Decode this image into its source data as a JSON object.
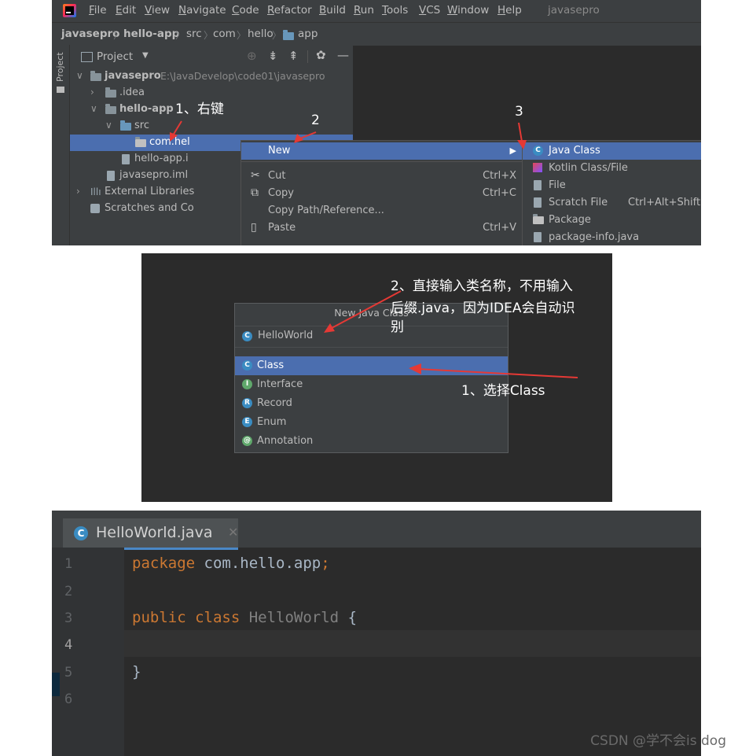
{
  "panel1": {
    "menu": [
      "File",
      "Edit",
      "View",
      "Navigate",
      "Code",
      "Refactor",
      "Build",
      "Run",
      "Tools",
      "VCS",
      "Window",
      "Help"
    ],
    "app_title": "javasepro",
    "breadcrumb": [
      "javasepro",
      "hello-app",
      "src",
      "com",
      "hello",
      "app"
    ],
    "project_tab": "Project",
    "project_header": "Project",
    "tree": {
      "root_name": "javasepro",
      "root_path": "E:\\JavaDevelop\\code01\\javasepro",
      "idea": ".idea",
      "module": "hello-app",
      "src": "src",
      "package": "com.hel",
      "module_iml": "hello-app.i",
      "project_iml": "javasepro.iml",
      "external_libs": "External Libraries",
      "scratches": "Scratches and Co"
    },
    "context_menu": {
      "new": "New",
      "cut": "Cut",
      "cut_sc": "Ctrl+X",
      "copy": "Copy",
      "copy_sc": "Ctrl+C",
      "copy_path": "Copy Path/Reference...",
      "paste": "Paste",
      "paste_sc": "Ctrl+V"
    },
    "submenu": {
      "java_class": "Java Class",
      "kotlin": "Kotlin Class/File",
      "file": "File",
      "scratch": "Scratch File",
      "scratch_sc": "Ctrl+Alt+Shift+Insert",
      "package": "Package",
      "package_info": "package-info.java"
    },
    "annotations": [
      "1、右键",
      "2",
      "3"
    ]
  },
  "panel2": {
    "dialog_title": "New Java Class",
    "input_value": "HelloWorld",
    "options": [
      "Class",
      "Interface",
      "Record",
      "Enum",
      "Annotation"
    ],
    "annotation_top_line1": "2、直接输入类名称，不用输入",
    "annotation_top_line2": "后缀.java，因为IDEA会自动识",
    "annotation_top_line3": "别",
    "annotation_bottom": "1、选择Class"
  },
  "panel3": {
    "tab_name": "HelloWorld.java",
    "line_numbers": [
      "1",
      "2",
      "3",
      "4",
      "5",
      "6"
    ],
    "code": {
      "l1_kw": "package",
      "l1_rest": " com.hello.app",
      "l1_semi": ";",
      "l3_kw": "public class",
      "l3_name": " HelloWorld",
      "l3_brace": " {",
      "l5": "}"
    }
  },
  "watermark": "CSDN @学不会is dog",
  "colors": {
    "selection": "#4b6eaf",
    "keyword": "#cc7832",
    "annotation_arrow": "#e53935",
    "class_icon": "#3a8cc2"
  }
}
